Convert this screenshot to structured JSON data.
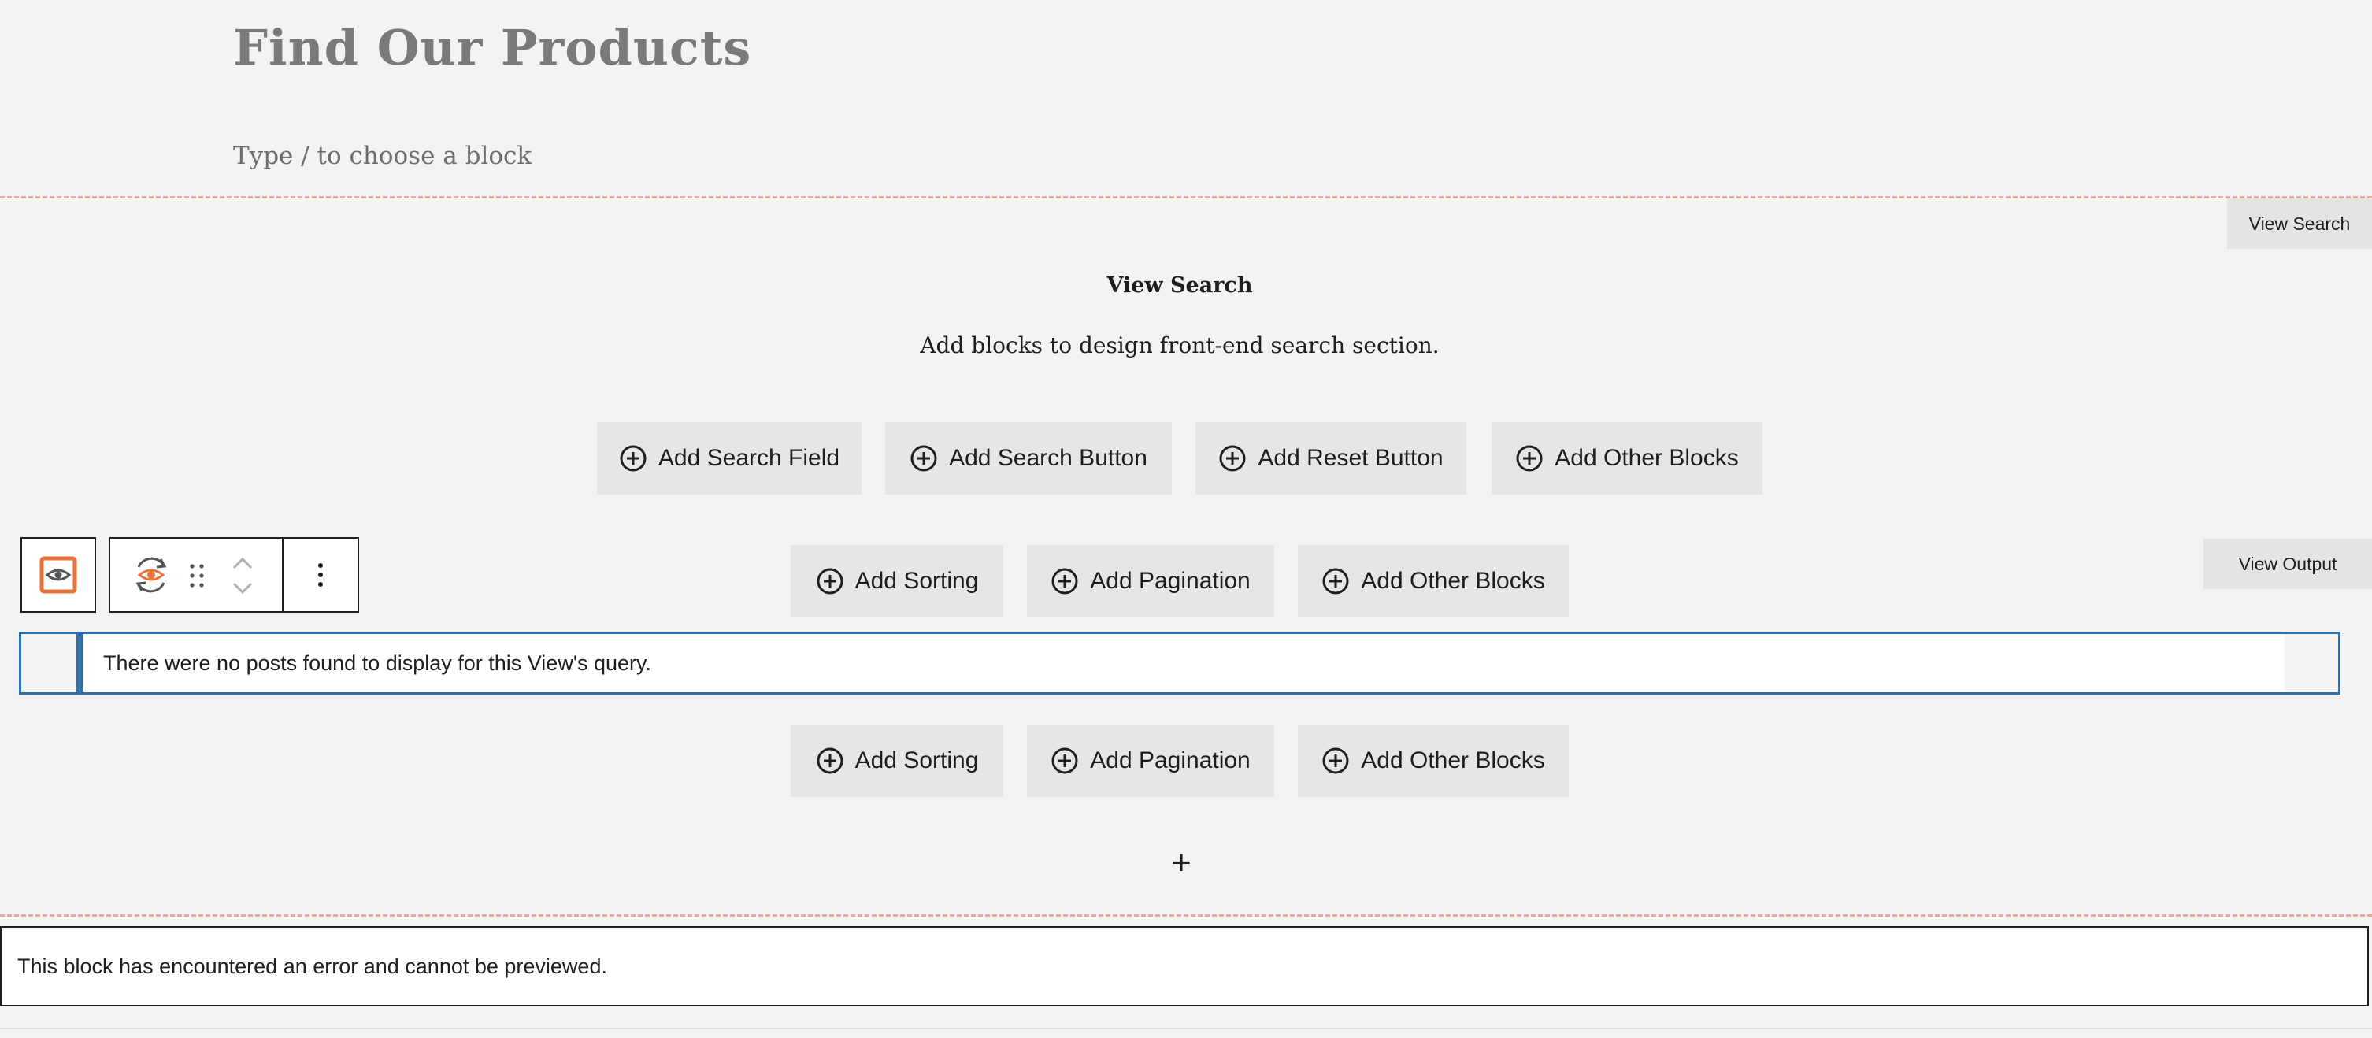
{
  "page": {
    "title": "Find Our Products",
    "block_placeholder": "Type / to choose a block"
  },
  "view_search": {
    "tag_label": "View Search",
    "heading": "View Search",
    "description": "Add blocks to design front-end search section.",
    "buttons": {
      "add_search_field": "Add Search Field",
      "add_search_button": "Add Search Button",
      "add_reset_button": "Add Reset Button",
      "add_other_blocks": "Add Other Blocks"
    }
  },
  "view_output": {
    "tag_label": "View Output",
    "top_buttons": {
      "add_sorting": "Add Sorting",
      "add_pagination": "Add Pagination",
      "add_other_blocks": "Add Other Blocks"
    },
    "notice": "There were no posts found to display for this View's query.",
    "bottom_buttons": {
      "add_sorting": "Add Sorting",
      "add_pagination": "Add Pagination",
      "add_other_blocks": "Add Other Blocks"
    },
    "inserter_symbol": "+"
  },
  "toolbar": {
    "icons": [
      "view-block-icon",
      "refresh-eye-icon",
      "drag-handle-icon",
      "move-up-icon",
      "move-down-icon",
      "more-options-icon"
    ],
    "more_symbol": "⋮"
  },
  "error_message": "This block has encountered an error and cannot be previewed.",
  "colors": {
    "background": "#f3f3f3",
    "accent_orange": "#e8743b",
    "notice_blue": "#2f6fad",
    "dashed_separator": "#e7a9a0",
    "button_bg": "#e6e6e6"
  }
}
